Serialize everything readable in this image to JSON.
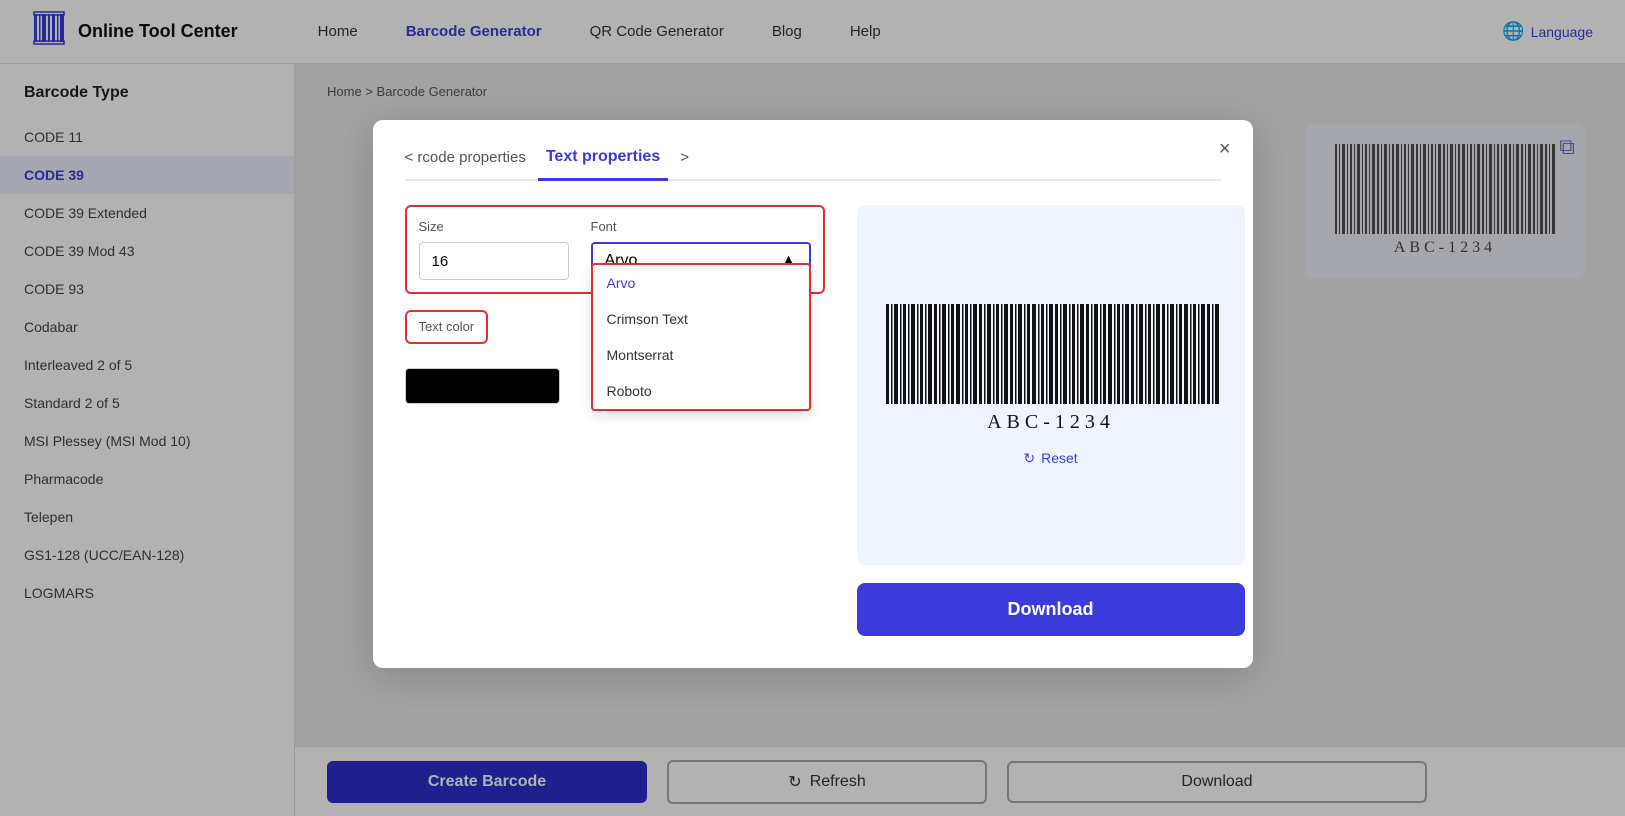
{
  "header": {
    "logo_icon": "|||||||",
    "logo_text": "Online Tool Center",
    "nav": [
      {
        "label": "Home",
        "active": false
      },
      {
        "label": "Barcode Generator",
        "active": true
      },
      {
        "label": "QR Code Generator",
        "active": false
      },
      {
        "label": "Blog",
        "active": false
      },
      {
        "label": "Help",
        "active": false
      }
    ],
    "language_label": "Language"
  },
  "sidebar": {
    "title": "Barcode Type",
    "items": [
      {
        "label": "CODE 11",
        "active": false
      },
      {
        "label": "CODE 39",
        "active": true
      },
      {
        "label": "CODE 39 Extended",
        "active": false
      },
      {
        "label": "CODE 39 Mod 43",
        "active": false
      },
      {
        "label": "CODE 93",
        "active": false
      },
      {
        "label": "Codabar",
        "active": false
      },
      {
        "label": "Interleaved 2 of 5",
        "active": false
      },
      {
        "label": "Standard 2 of 5",
        "active": false
      },
      {
        "label": "MSI Plessey (MSI Mod 10)",
        "active": false
      },
      {
        "label": "Pharmacode",
        "active": false
      },
      {
        "label": "Telepen",
        "active": false
      },
      {
        "label": "GS1-128 (UCC/EAN-128)",
        "active": false
      },
      {
        "label": "LOGMARS",
        "active": false
      }
    ]
  },
  "breadcrumb": {
    "home": "Home",
    "separator": ">",
    "current": "Barcode Generator"
  },
  "modal": {
    "tab_prev": "< rcode properties",
    "tab_active": "Text properties",
    "tab_next": ">",
    "size_tab": "Size",
    "font_tab": "Font",
    "size_value": "16",
    "font_selected": "Arvo",
    "font_options": [
      {
        "label": "Arvo",
        "selected": true
      },
      {
        "label": "Crimson Text",
        "selected": false
      },
      {
        "label": "Montserrat",
        "selected": false
      },
      {
        "label": "Roboto",
        "selected": false
      }
    ],
    "text_color_label": "Text color",
    "color_value": "#000000",
    "barcode_text": "ABC-1234",
    "reset_label": "Reset",
    "download_label": "Download",
    "close_label": "×"
  },
  "bottom_bar": {
    "create_label": "Create Barcode",
    "refresh_label": "Refresh",
    "download_label": "Download"
  },
  "icons": {
    "globe": "🌐",
    "refresh": "↻",
    "reset": "↻",
    "copy": "⧉",
    "chevron_left": "‹",
    "chevron_right": "›"
  }
}
